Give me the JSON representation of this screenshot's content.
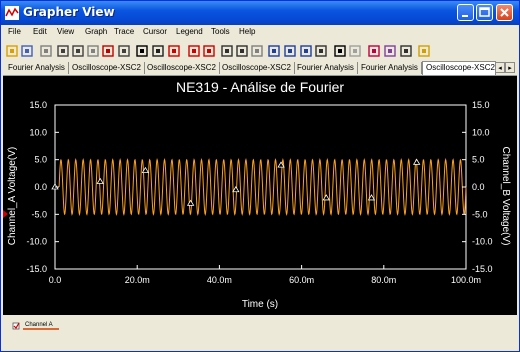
{
  "window": {
    "title": "Grapher View"
  },
  "menu": [
    "File",
    "Edit",
    "View",
    "Graph",
    "Trace",
    "Cursor",
    "Legend",
    "Tools",
    "Help"
  ],
  "toolbar": {
    "icons": [
      "open-icon",
      "save-icon",
      "undo-icon",
      "cut-icon",
      "copy-icon",
      "paste-icon",
      "grid-icon",
      "toggle-grid-icon",
      "toggle-legend-icon",
      "overlay-icon",
      "cursors-icon",
      "prev-point-icon",
      "next-point-icon",
      "zoom-in-icon",
      "zoom-out-icon",
      "zoom-icon",
      "zoom-x-icon",
      "zoom-y-icon",
      "zoom-fit-icon",
      "pan-icon",
      "text-icon",
      "marker-icon",
      "reverse-colors-icon",
      "export-icon",
      "copy-graph-icon",
      "overlay-traces-icon"
    ]
  },
  "tabs": [
    {
      "label": "Fourier Analysis",
      "active": false
    },
    {
      "label": "Oscilloscope-XSC2",
      "active": false
    },
    {
      "label": "Oscilloscope-XSC2",
      "active": false
    },
    {
      "label": "Oscilloscope-XSC2",
      "active": false
    },
    {
      "label": "Fourier Analysis",
      "active": false
    },
    {
      "label": "Fourier Analysis",
      "active": false
    },
    {
      "label": "Oscilloscope-XSC2",
      "active": true
    }
  ],
  "legend": {
    "channel_label": "Channel A",
    "checked": true
  },
  "colors": {
    "trace": "#ffa020",
    "trace_dark": "#ff5000",
    "background": "#000000",
    "axis": "#ffffff",
    "legend_line": "#d04000"
  },
  "chart_data": {
    "type": "line",
    "title": "NE319 - Análise de Fourier",
    "xlabel": "Time (s)",
    "ylabel": "Channel_A Voltage(V)",
    "ylabel_right": "Channel_B Voltage(V)",
    "xlim": [
      0.0,
      0.1
    ],
    "ylim": [
      -15.0,
      15.0
    ],
    "x_ticks": [
      "0.0",
      "20.0m",
      "40.0m",
      "60.0m",
      "80.0m",
      "100.0m"
    ],
    "x_tick_values": [
      0.0,
      0.02,
      0.04,
      0.06,
      0.08,
      0.1
    ],
    "y_ticks": [
      "15.0",
      "10.0",
      "5.0",
      "0.0",
      "-5.0",
      "-10.0",
      "-15.0"
    ],
    "y_tick_values": [
      15,
      10,
      5,
      0,
      -5,
      -10,
      -15
    ],
    "grid": false,
    "series": [
      {
        "name": "Channel A",
        "amplitude": 5.0,
        "period_count": 55,
        "x_start": 0.001,
        "x_end": 0.1
      }
    ],
    "markers": [
      {
        "x": 0.0,
        "y": 0.0
      },
      {
        "x": 0.011,
        "y": 1.0
      },
      {
        "x": 0.022,
        "y": 3.0
      },
      {
        "x": 0.033,
        "y": -3.0
      },
      {
        "x": 0.044,
        "y": -0.5
      },
      {
        "x": 0.055,
        "y": 4.0
      },
      {
        "x": 0.066,
        "y": -2.0
      },
      {
        "x": 0.077,
        "y": -2.0
      },
      {
        "x": 0.088,
        "y": 4.5
      }
    ]
  }
}
